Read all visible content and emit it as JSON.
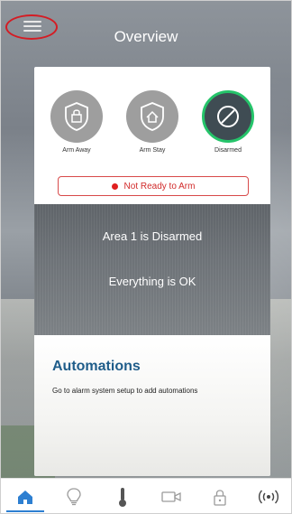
{
  "header": {
    "title": "Overview"
  },
  "modes": [
    {
      "label": "Arm Away",
      "icon": "shield-lock-icon",
      "selected": false
    },
    {
      "label": "Arm Stay",
      "icon": "shield-home-icon",
      "selected": false
    },
    {
      "label": "Disarmed",
      "icon": "disarm-icon",
      "selected": true
    }
  ],
  "status_pill": {
    "text": "Not Ready to Arm",
    "color": "#d12a2a"
  },
  "status": {
    "line1": "Area 1 is Disarmed",
    "line2": "Everything is OK"
  },
  "automations": {
    "title": "Automations",
    "description": "Go to alarm system setup to add automations"
  },
  "bottom_nav": [
    {
      "name": "home",
      "icon": "home-icon",
      "active": true
    },
    {
      "name": "lights",
      "icon": "lightbulb-icon",
      "active": false
    },
    {
      "name": "thermostat",
      "icon": "thermometer-icon",
      "active": false
    },
    {
      "name": "camera",
      "icon": "video-camera-icon",
      "active": false
    },
    {
      "name": "locks",
      "icon": "lock-icon",
      "active": false
    },
    {
      "name": "sensors",
      "icon": "wireless-icon",
      "active": false
    }
  ],
  "colors": {
    "accent": "#2d7fd1",
    "disarmed_ring": "#25c46a",
    "alert": "#e01f1f",
    "highlight_ring": "#d41c24",
    "heading": "#1f5d8a"
  }
}
